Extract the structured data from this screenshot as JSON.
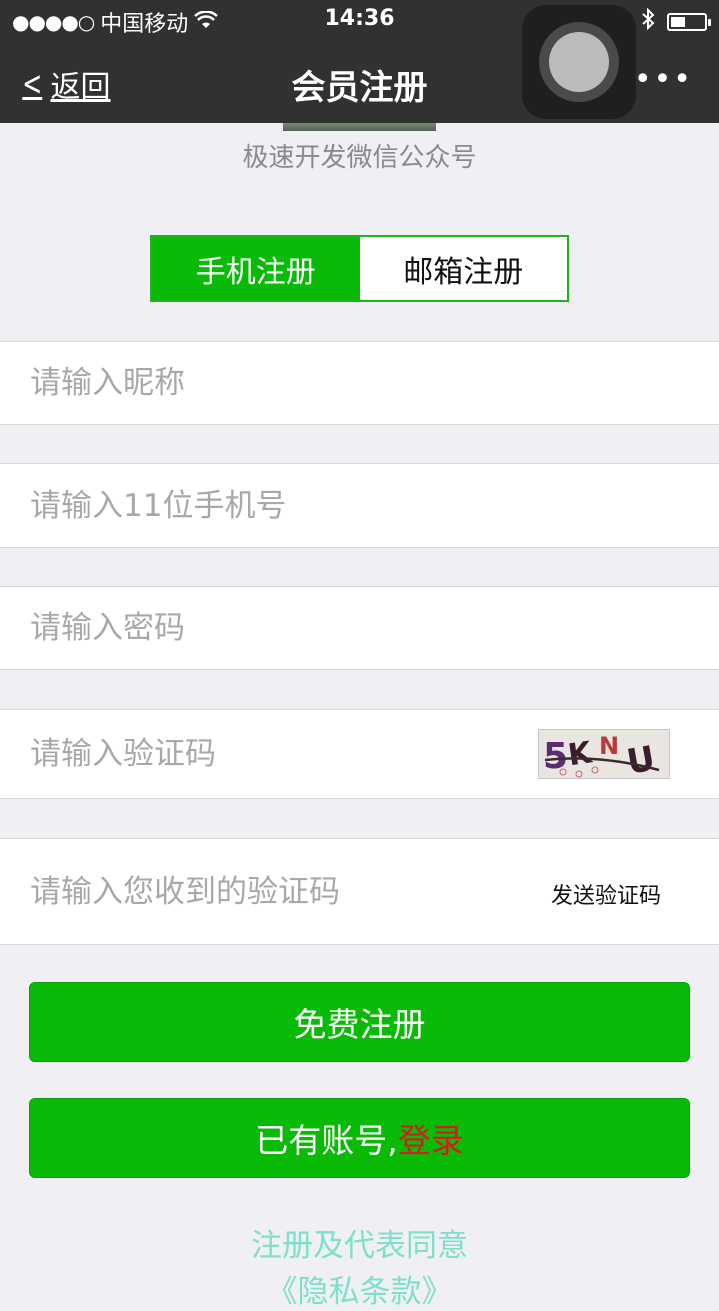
{
  "status_bar": {
    "signal": "●●●●○",
    "carrier": "中国移动",
    "time": "14:36"
  },
  "nav": {
    "back_label": "返回",
    "title": "会员注册",
    "more": "•••"
  },
  "header": {
    "brand_name": "极速开发微信公众号"
  },
  "tabs": [
    {
      "label": "手机注册",
      "active": true
    },
    {
      "label": "邮箱注册",
      "active": false
    }
  ],
  "form": {
    "nickname_placeholder": "请输入昵称",
    "phone_placeholder": "请输入11位手机号",
    "password_placeholder": "请输入密码",
    "captcha_placeholder": "请输入验证码",
    "captcha_text": "5KNU",
    "sms_code_placeholder": "请输入您收到的验证码",
    "send_code_label": "发送验证码"
  },
  "buttons": {
    "register_label": "免费注册",
    "has_account_label": "已有账号,",
    "login_label": "登录"
  },
  "footer": {
    "agree_text": "注册及代表同意",
    "policy_text": "《隐私条款》"
  },
  "colors": {
    "accent_green": "#09bb07",
    "login_red": "#d21e1e",
    "link_teal": "#7fe0c9"
  }
}
